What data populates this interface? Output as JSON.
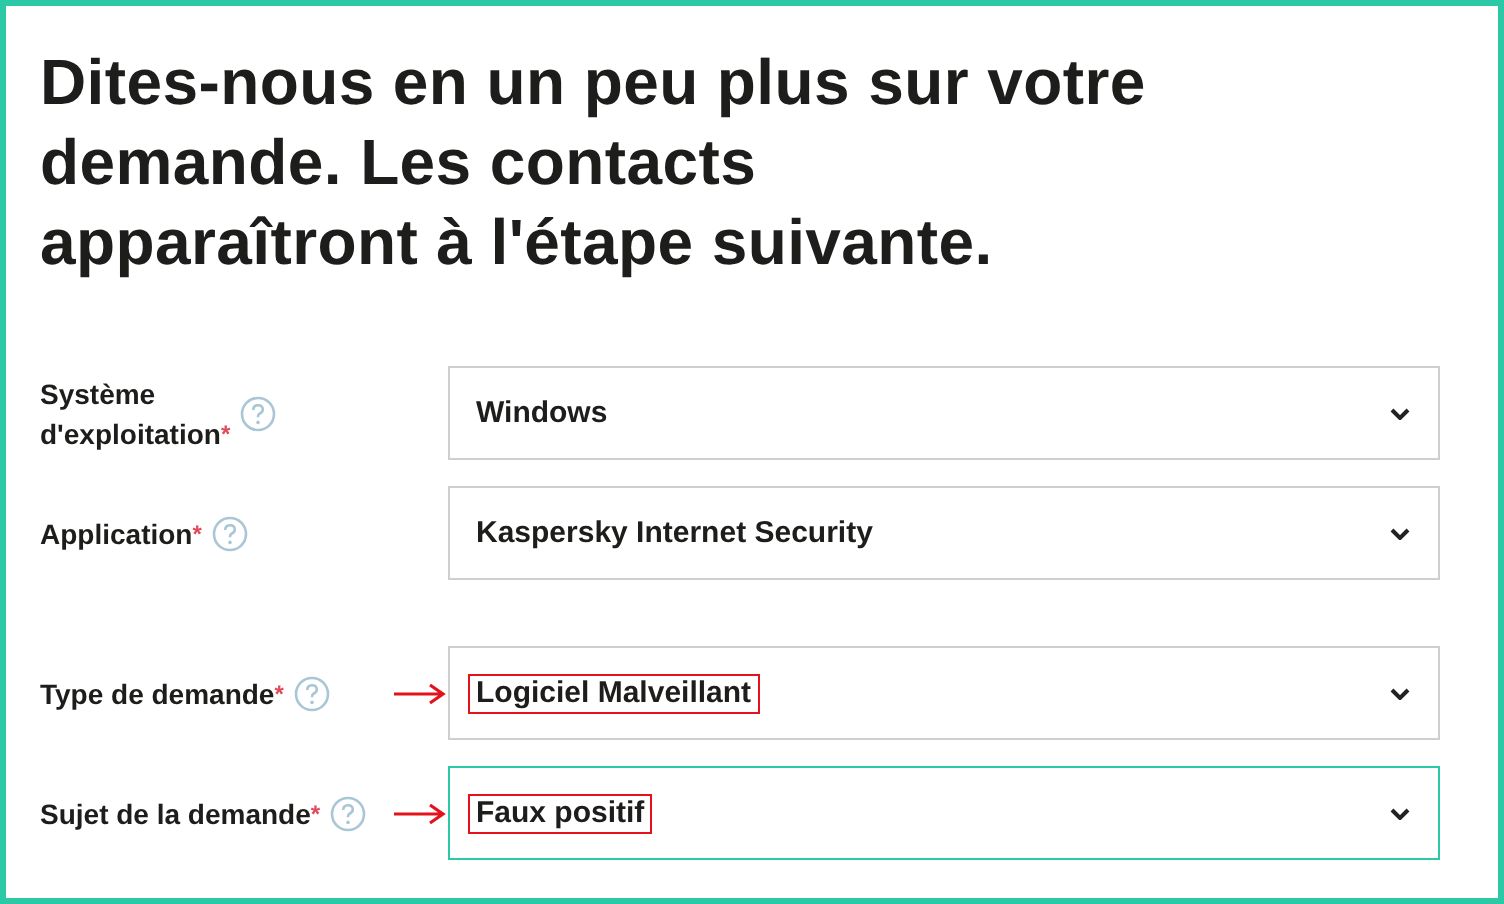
{
  "heading": {
    "lines": [
      "Dites-nous en un peu plus sur votre",
      "demande. Les contacts",
      "apparaîtront à l'étape suivante."
    ]
  },
  "field_groups": [
    [
      {
        "label_lines": [
          "Système",
          "d'exploitation"
        ],
        "required_mark": "*",
        "value": "Windows",
        "focused": false,
        "annotated": false
      },
      {
        "label_lines": [
          "Application"
        ],
        "required_mark": "*",
        "value": "Kaspersky Internet Security",
        "focused": false,
        "annotated": false
      }
    ],
    [
      {
        "label_lines": [
          "Type de demande"
        ],
        "required_mark": "*",
        "value": "Logiciel Malveillant",
        "focused": false,
        "annotated": true
      },
      {
        "label_lines": [
          "Sujet de la demande"
        ],
        "required_mark": "*",
        "value": "Faux positif",
        "focused": true,
        "annotated": true
      }
    ]
  ]
}
